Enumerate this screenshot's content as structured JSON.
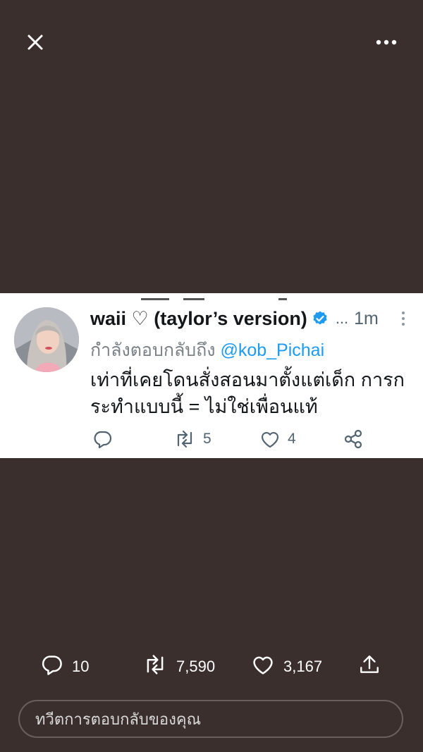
{
  "topbar": {
    "close_icon": "close-icon",
    "more_icon": "more-horizontal-icon"
  },
  "tweet": {
    "display_name": "waii ♡ (taylor’s version)",
    "verified_icon": "verified-badge-icon",
    "truncation": "...",
    "time": "1m",
    "replying_prefix": "กำลังตอบกลับถึง",
    "replying_to": "@kob_Pichai",
    "text_line1": "เท่าที่เคยโดนสั่งสอนมาตั้งแต่เด็ก การก",
    "text_line2": "ระทำแบบนี้ = ไม่ใช่เพื่อนแท้",
    "actions": {
      "reply_icon": "reply-icon",
      "retweet_icon": "retweet-icon",
      "retweet_count": "5",
      "like_icon": "heart-icon",
      "like_count": "4",
      "share_icon": "share-icon"
    }
  },
  "stats": {
    "replies": "10",
    "retweets": "7,590",
    "likes": "3,167"
  },
  "reply_input": {
    "placeholder": "ทวีตการตอบกลับของคุณ"
  },
  "colors": {
    "background": "#3a2f2d",
    "card": "#ffffff",
    "accent": "#1d9bf0",
    "muted": "#536471"
  }
}
